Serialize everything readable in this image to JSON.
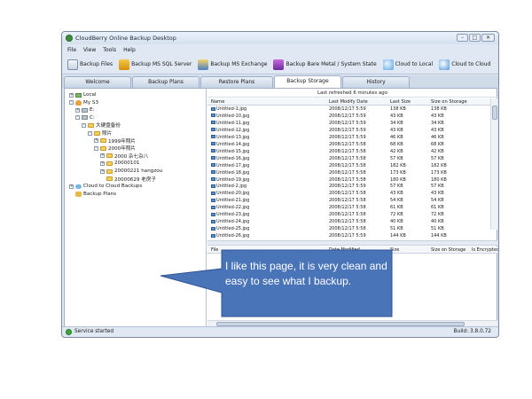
{
  "window": {
    "title": "CloudBerry Online Backup Desktop"
  },
  "menu": [
    "File",
    "View",
    "Tools",
    "Help"
  ],
  "toolbar": [
    {
      "label": "Backup Files",
      "icon": "backup-files-icon"
    },
    {
      "label": "Backup MS SQL Server",
      "icon": "sql-server-icon"
    },
    {
      "label": "Backup MS Exchange",
      "icon": "exchange-icon"
    },
    {
      "label": "Backup Bare Metal / System State",
      "icon": "bare-metal-icon"
    },
    {
      "label": "Cloud to Local",
      "icon": "cloud-to-local-icon"
    },
    {
      "label": "Cloud to Cloud",
      "icon": "cloud-to-cloud-icon"
    }
  ],
  "tabs": [
    "Welcome",
    "Backup Plans",
    "Restore Plans",
    "Backup Storage",
    "History"
  ],
  "active_tab": "Backup Storage",
  "tree": [
    {
      "label": "Local",
      "level": 0,
      "exp": "+",
      "icon": "local-icon"
    },
    {
      "label": "My S3",
      "level": 0,
      "exp": "-",
      "icon": "s3-icon"
    },
    {
      "label": "E:",
      "level": 1,
      "exp": "+",
      "icon": "drive-icon"
    },
    {
      "label": "C:",
      "level": 1,
      "exp": "-",
      "icon": "drive-icon"
    },
    {
      "label": "大硬盘备份",
      "level": 2,
      "exp": "-",
      "icon": "folder-icon"
    },
    {
      "label": "照片",
      "level": 3,
      "exp": "-",
      "icon": "folder-icon"
    },
    {
      "label": "1999年照片",
      "level": 4,
      "exp": "+",
      "icon": "folder-icon"
    },
    {
      "label": "2000年照片",
      "level": 4,
      "exp": "-",
      "icon": "folder-icon"
    },
    {
      "label": "2000 杂七杂八",
      "level": 5,
      "exp": "+",
      "icon": "folder-icon"
    },
    {
      "label": "20000101",
      "level": 5,
      "exp": "+",
      "icon": "folder-icon"
    },
    {
      "label": "20000221 hangzou",
      "level": 5,
      "exp": "+",
      "icon": "folder-icon"
    },
    {
      "label": "20000629 老房子",
      "level": 5,
      "exp": "",
      "icon": "folder-icon"
    },
    {
      "label": "Cloud to Cloud Backups",
      "level": 0,
      "exp": "+",
      "icon": "cloud-icon"
    },
    {
      "label": "Backup Plans",
      "level": 0,
      "exp": "",
      "icon": "backup-plans-icon"
    }
  ],
  "storage": {
    "refreshed": "Last refreshed 6 minutes ago",
    "columns": [
      "Name",
      "Last Modify Date",
      "Last Size",
      "Size on Storage"
    ],
    "rows": [
      [
        "Untitled-1.jpg",
        "2008/12/17 5:59",
        "138 KB",
        "138 KB"
      ],
      [
        "Untitled-10.jpg",
        "2008/12/17 5:59",
        "43 KB",
        "43 KB"
      ],
      [
        "Untitled-11.jpg",
        "2008/12/17 5:59",
        "34 KB",
        "34 KB"
      ],
      [
        "Untitled-12.jpg",
        "2008/12/17 5:59",
        "43 KB",
        "43 KB"
      ],
      [
        "Untitled-13.jpg",
        "2008/12/17 5:59",
        "46 KB",
        "46 KB"
      ],
      [
        "Untitled-14.jpg",
        "2008/12/17 5:58",
        "68 KB",
        "68 KB"
      ],
      [
        "Untitled-15.jpg",
        "2008/12/17 5:58",
        "42 KB",
        "42 KB"
      ],
      [
        "Untitled-16.jpg",
        "2008/12/17 5:58",
        "57 KB",
        "57 KB"
      ],
      [
        "Untitled-17.jpg",
        "2008/12/17 5:58",
        "182 KB",
        "182 KB"
      ],
      [
        "Untitled-18.jpg",
        "2008/12/17 5:58",
        "173 KB",
        "173 KB"
      ],
      [
        "Untitled-19.jpg",
        "2008/12/17 5:58",
        "180 KB",
        "180 KB"
      ],
      [
        "Untitled-2.jpg",
        "2008/12/17 5:59",
        "57 KB",
        "57 KB"
      ],
      [
        "Untitled-20.jpg",
        "2008/12/17 5:58",
        "43 KB",
        "43 KB"
      ],
      [
        "Untitled-21.jpg",
        "2008/12/17 5:58",
        "54 KB",
        "54 KB"
      ],
      [
        "Untitled-22.jpg",
        "2008/12/17 5:58",
        "61 KB",
        "61 KB"
      ],
      [
        "Untitled-23.jpg",
        "2008/12/17 5:58",
        "72 KB",
        "72 KB"
      ],
      [
        "Untitled-24.jpg",
        "2008/12/17 5:58",
        "40 KB",
        "40 KB"
      ],
      [
        "Untitled-25.jpg",
        "2008/12/17 5:58",
        "51 KB",
        "51 KB"
      ],
      [
        "Untitled-26.jpg",
        "2008/12/17 5:59",
        "144 KB",
        "144 KB"
      ]
    ],
    "detail_columns": [
      "File",
      "Date Modified",
      "Size",
      "Size on Storage",
      "Is Encrypted"
    ]
  },
  "status": {
    "text": "Service started",
    "build": "Build: 3.8.0.72"
  },
  "callout": {
    "text": "I like this page, it is very clean and easy to see what I backup.",
    "color": "#4a74b8"
  }
}
